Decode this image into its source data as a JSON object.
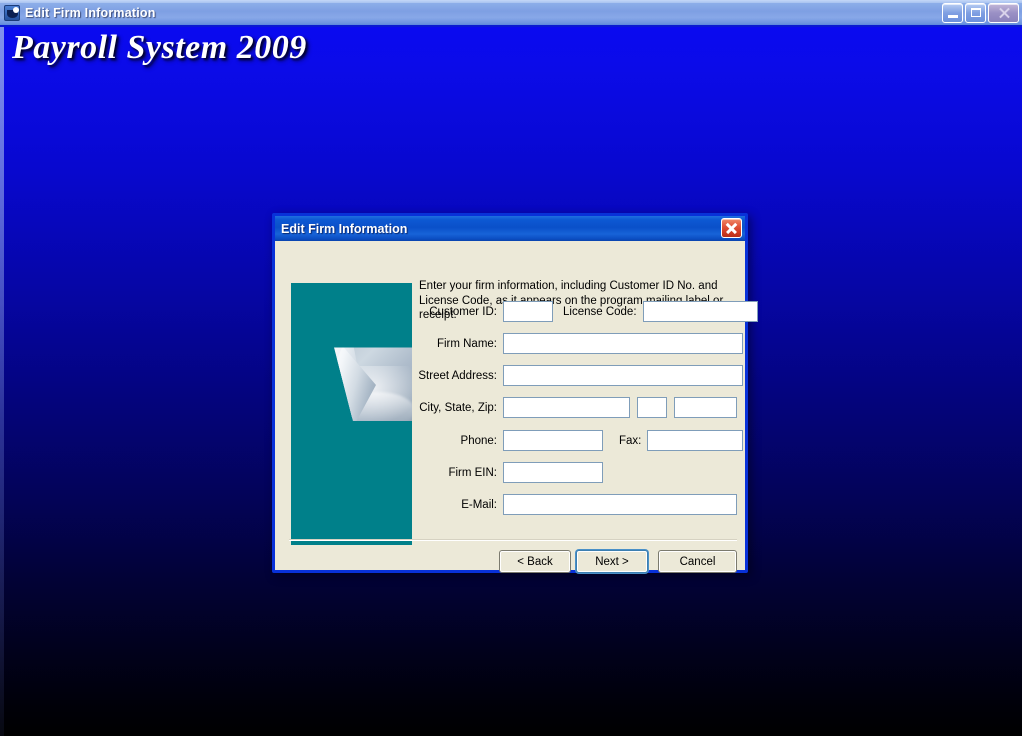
{
  "main_window": {
    "title": "Edit Firm Information",
    "icon": "app-icon",
    "banner_title": "Payroll System 2009",
    "controls": {
      "minimize": "Minimize",
      "restore": "Restore",
      "close": "Close"
    }
  },
  "dialog": {
    "title": "Edit Firm Information",
    "close_label": "Close",
    "instructions": "Enter your firm information, including Customer ID No. and License Code, as it appears on the program mailing label or receipt.",
    "fields": {
      "customer_id": {
        "label": "Customer ID:",
        "value": "",
        "placeholder": ""
      },
      "license_code": {
        "label": "License Code:",
        "value": "",
        "placeholder": ""
      },
      "firm_name": {
        "label": "Firm Name:",
        "value": "",
        "placeholder": ""
      },
      "street_address": {
        "label": "Street Address:",
        "value": "",
        "placeholder": ""
      },
      "city_state_zip": {
        "label": "City, State, Zip:",
        "city": "",
        "state": "",
        "zip": ""
      },
      "phone": {
        "label": "Phone:",
        "value": "",
        "placeholder": ""
      },
      "fax": {
        "label": "Fax:",
        "value": "",
        "placeholder": ""
      },
      "firm_ein": {
        "label": "Firm EIN:",
        "value": "",
        "placeholder": ""
      },
      "email": {
        "label": "E-Mail:",
        "value": "",
        "placeholder": ""
      }
    },
    "buttons": {
      "back": "< Back",
      "next": "Next >",
      "cancel": "Cancel"
    }
  },
  "colors": {
    "desktop_top": "#0a0af0",
    "desktop_bottom": "#000000",
    "dialog_face": "#ece9d8",
    "dialog_border": "#0831d9",
    "side_panel": "#00808a",
    "field_border": "#7f9db9",
    "close_button": "#cf3a22"
  }
}
